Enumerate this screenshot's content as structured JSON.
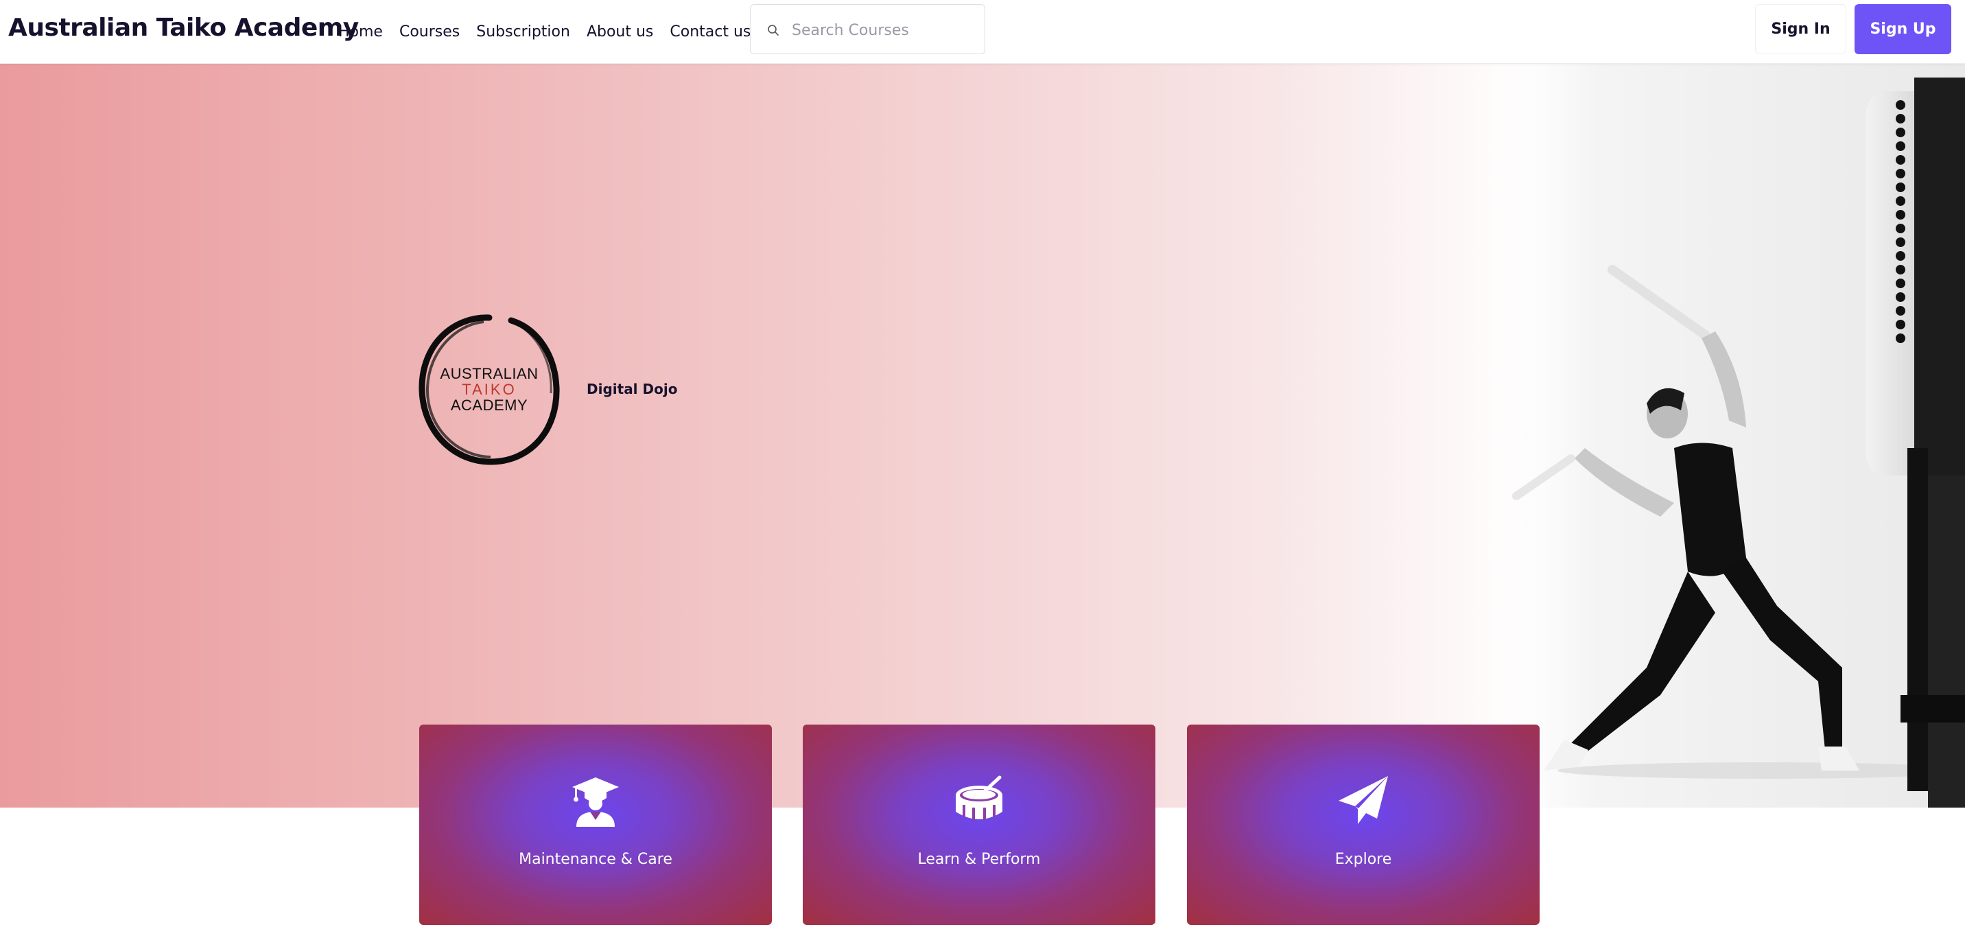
{
  "header": {
    "brand": "Australian Taiko Academy",
    "nav": {
      "home": "Home",
      "courses": "Courses",
      "subscription": "Subscription",
      "about": "About us",
      "contact": "Contact us"
    },
    "search": {
      "placeholder": "Search Courses",
      "value": ""
    },
    "sign_in": "Sign In",
    "sign_up": "Sign Up"
  },
  "hero": {
    "logo": {
      "line1": "AUSTRALIAN",
      "line2": "TAIKO",
      "line3": "ACADEMY"
    },
    "tagline": "Digital Dojo",
    "photo_icon": "taiko-drummer-photo"
  },
  "cards": [
    {
      "label": "Maintenance & Care",
      "icon": "graduate-icon"
    },
    {
      "label": "Learn & Perform",
      "icon": "drum-icon"
    },
    {
      "label": "Explore",
      "icon": "paper-plane-icon"
    }
  ],
  "colors": {
    "accent": "#6e54f7",
    "text_dark": "#16122e",
    "hero_pink": "#ea9b9d",
    "card_red": "#a23040",
    "card_purple": "#6c46ef",
    "logo_red": "#c0392b"
  }
}
